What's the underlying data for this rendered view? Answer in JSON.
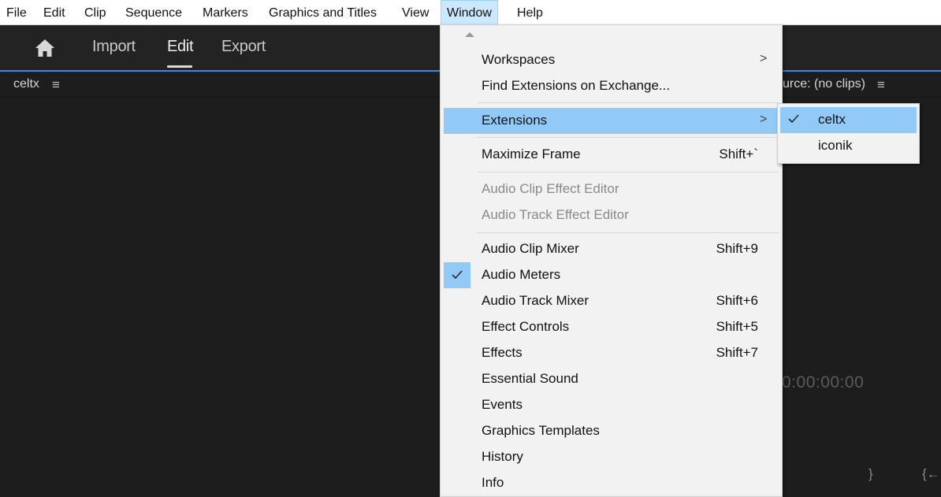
{
  "menubar": {
    "items": [
      "File",
      "Edit",
      "Clip",
      "Sequence",
      "Markers",
      "Graphics and Titles",
      "View",
      "Window",
      "Help"
    ],
    "active": "Window"
  },
  "header": {
    "tabs": [
      "Import",
      "Edit",
      "Export"
    ],
    "active_tab": "Edit",
    "home_icon": "home-icon"
  },
  "panels": {
    "left_title": "celtx",
    "right_title": "urce: (no clips)",
    "menu_icon": "≡",
    "timecode": "0:00:00:00",
    "bottom_icons": [
      "}",
      "{←"
    ]
  },
  "window_menu": {
    "workspaces": "Workspaces",
    "find_extensions": "Find Extensions on Exchange...",
    "extensions": "Extensions",
    "maximize_frame": "Maximize Frame",
    "maximize_frame_shortcut": "Shift+`",
    "audio_clip_effect_editor": "Audio Clip Effect Editor",
    "audio_track_effect_editor": "Audio Track Effect Editor",
    "audio_clip_mixer": "Audio Clip Mixer",
    "audio_clip_mixer_shortcut": "Shift+9",
    "audio_meters": "Audio Meters",
    "audio_track_mixer": "Audio Track Mixer",
    "audio_track_mixer_shortcut": "Shift+6",
    "effect_controls": "Effect Controls",
    "effect_controls_shortcut": "Shift+5",
    "effects": "Effects",
    "effects_shortcut": "Shift+7",
    "essential_sound": "Essential Sound",
    "events": "Events",
    "graphics_templates": "Graphics Templates",
    "history": "History",
    "info": "Info",
    "submenu_arrow": ">"
  },
  "extensions_submenu": {
    "items": [
      "celtx",
      "iconik"
    ],
    "checked": "celtx"
  },
  "colors": {
    "accent": "#2d8ceb",
    "highlight": "#91c9f7",
    "menu_bg": "#f2f2f2",
    "app_bg": "#1d1d1d"
  }
}
